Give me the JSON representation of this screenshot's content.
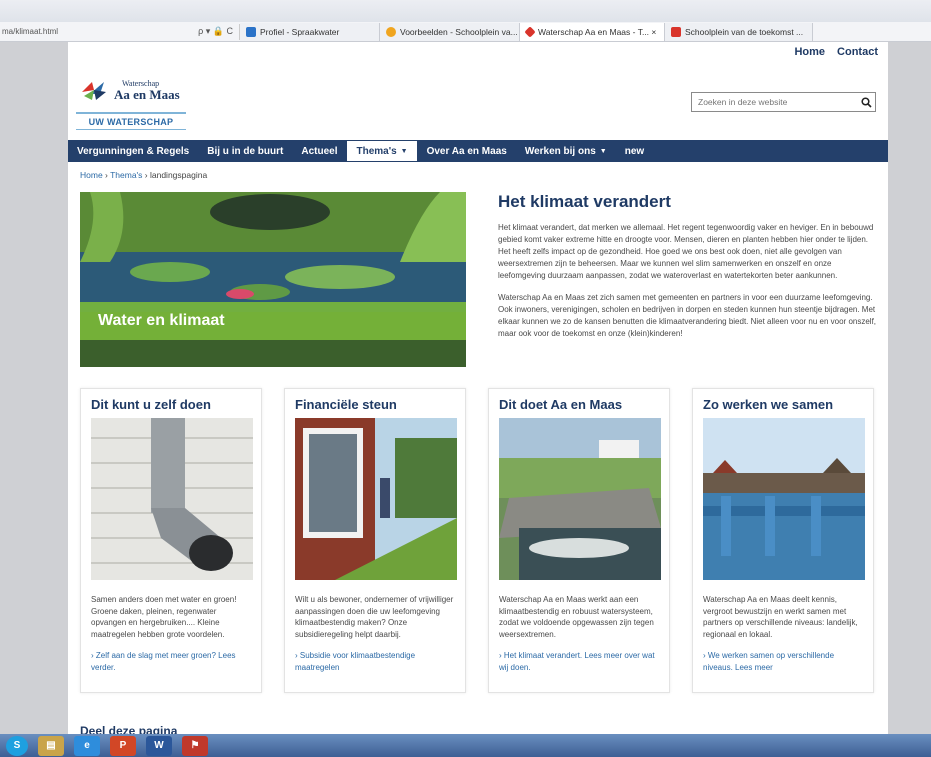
{
  "browser": {
    "url": "ma/klimaat.html",
    "url_controls": "ρ ▾ 🔒 C",
    "tabs": [
      {
        "label": "Profiel - Spraakwater",
        "color": "#2b73c8",
        "active": false
      },
      {
        "label": "Voorbeelden - Schoolplein va...",
        "color": "#f0a51f",
        "active": false
      },
      {
        "label": "Waterschap Aa en Maas - T... ×",
        "color": "#d9342b",
        "active": true
      },
      {
        "label": "Schoolplein van de toekomst ...",
        "color": "#d9342b",
        "active": false
      }
    ]
  },
  "header": {
    "links": [
      "Home",
      "Contact"
    ],
    "logo_small": "Waterschap",
    "logo_big": "Aa en Maas",
    "uw_button": "UW WATERSCHAP",
    "search_placeholder": "Zoeken in deze website"
  },
  "nav": [
    {
      "label": "Vergunningen & Regels",
      "caret": "",
      "active": false
    },
    {
      "label": "Bij u in de buurt",
      "caret": "",
      "active": false
    },
    {
      "label": "Actueel",
      "caret": "",
      "active": false
    },
    {
      "label": "Thema's",
      "caret": "▼",
      "active": true
    },
    {
      "label": "Over Aa en Maas",
      "caret": "",
      "active": false
    },
    {
      "label": "Werken bij ons",
      "caret": "▼",
      "active": false
    },
    {
      "label": "new",
      "caret": "",
      "active": false
    }
  ],
  "breadcrumb": {
    "home": "Home",
    "sep1": " › ",
    "themas": "Thema's",
    "sep2": " › ",
    "current": "landingspagina"
  },
  "hero": {
    "title": "Water en klimaat"
  },
  "intro": {
    "title": "Het klimaat verandert",
    "p1": "Het klimaat verandert, dat merken we allemaal. Het regent tegenwoordig vaker en heviger. En in bebouwd gebied komt vaker extreme hitte en droogte voor. Mensen, dieren en planten hebben hier onder te lijden. Het heeft zelfs impact op de gezondheid. Hoe goed we ons best ook doen, niet alle gevolgen van weersextremen zijn te beheersen. Maar we kunnen wel slim samenwerken en onszelf en onze leefomgeving duurzaam aanpassen, zodat we wateroverlast en watertekorten beter aankunnen.",
    "p2": "Waterschap Aa en Maas zet zich samen met gemeenten en partners in voor een duurzame leefomgeving. Ook inwoners, verenigingen, scholen en bedrijven in dorpen en steden kunnen hun steentje bijdragen. Met elkaar kunnen we zo de kansen benutten die klimaatverandering biedt. Niet alleen voor nu en voor onszelf, maar ook voor de toekomst en onze (klein)kinderen!"
  },
  "cards": [
    {
      "title": "Dit kunt u zelf doen",
      "text": "Samen anders doen met water en groen! Groene daken, pleinen, regenwater opvangen en hergebruiken.... Kleine maatregelen hebben grote voordelen.",
      "link": "› Zelf aan de slag met meer groen? Lees verder."
    },
    {
      "title": "Financiële steun",
      "text": "Wilt u als bewoner, ondernemer of vrijwilliger aanpassingen doen die uw leefomgeving klimaatbestendig maken? Onze subsidieregeling helpt daarbij.",
      "link": "› Subsidie voor klimaatbestendige maatregelen"
    },
    {
      "title": "Dit doet Aa en Maas",
      "text": "Waterschap Aa en Maas werkt aan een klimaatbestendig en robuust watersysteem, zodat we voldoende opgewassen zijn tegen weersextremen.",
      "link": "› Het klimaat verandert. Lees meer over wat wij doen."
    },
    {
      "title": "Zo werken we samen",
      "text": "Waterschap Aa en Maas deelt kennis, vergroot bewustzijn en werkt samen met partners op verschillende niveaus: landelijk, regionaal en lokaal.",
      "link": "› We werken samen op verschillende niveaus. Lees meer"
    }
  ],
  "bottom_heading": "Deel deze pagina",
  "taskbar": [
    {
      "name": "skype-icon",
      "glyph": "S",
      "color": "#1ea0e0"
    },
    {
      "name": "explorer-icon",
      "glyph": "▤",
      "color": "#c9a44a"
    },
    {
      "name": "ie-icon",
      "glyph": "e",
      "color": "#2e8ddc"
    },
    {
      "name": "powerpoint-icon",
      "glyph": "P",
      "color": "#d24726"
    },
    {
      "name": "word-icon",
      "glyph": "W",
      "color": "#2b579a"
    },
    {
      "name": "pdf-icon",
      "glyph": "⚑",
      "color": "#c0392b"
    }
  ]
}
